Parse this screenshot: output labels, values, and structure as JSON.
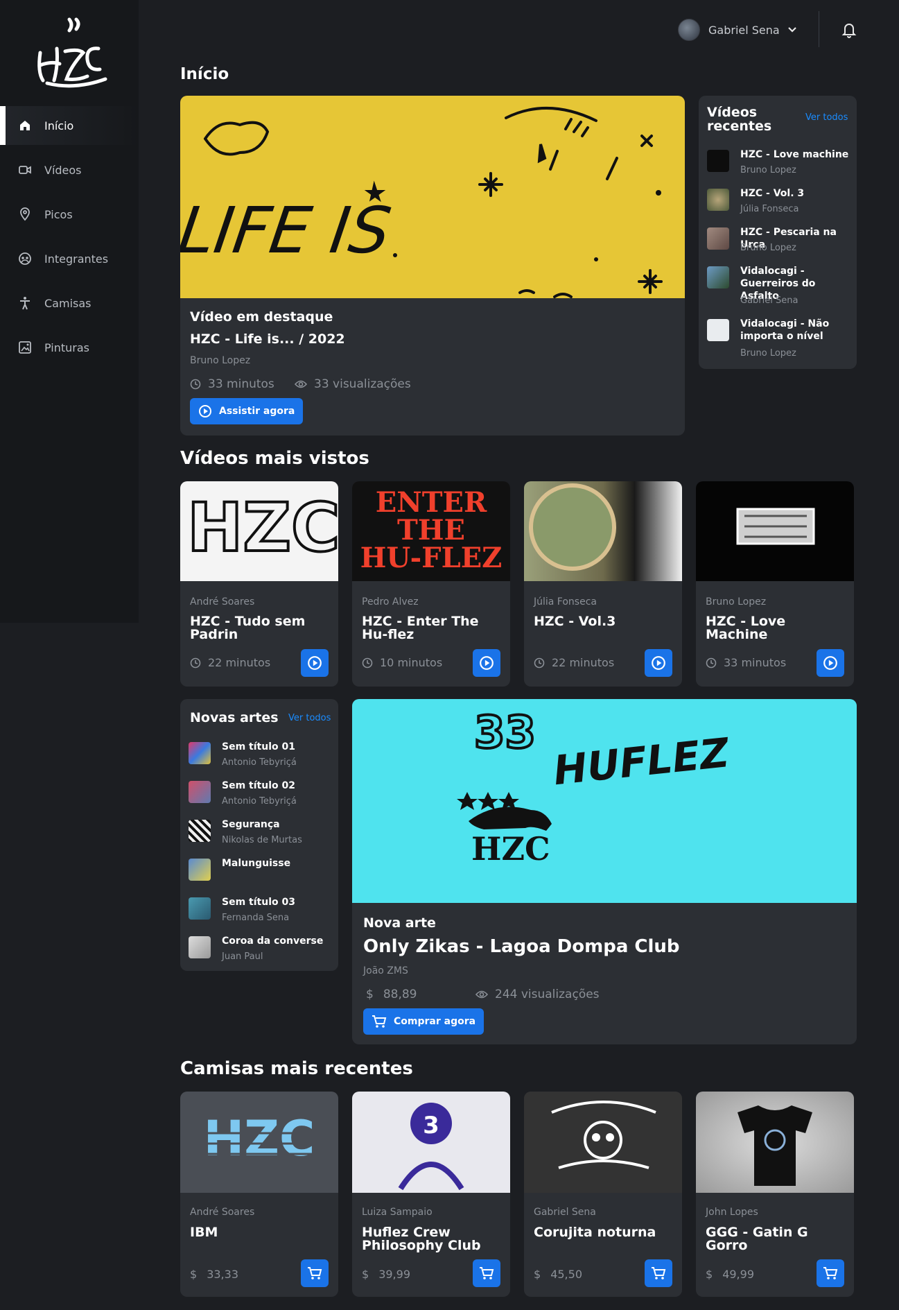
{
  "user": {
    "name": "Gabriel Sena"
  },
  "nav": [
    {
      "label": "Início",
      "icon": "home-icon"
    },
    {
      "label": "Vídeos",
      "icon": "video-camera-icon"
    },
    {
      "label": "Picos",
      "icon": "map-pin-icon"
    },
    {
      "label": "Integrantes",
      "icon": "people-icon"
    },
    {
      "label": "Camisas",
      "icon": "person-icon"
    },
    {
      "label": "Pinturas",
      "icon": "picture-icon"
    }
  ],
  "page_title": "Início",
  "featured": {
    "kicker": "Vídeo em destaque",
    "title": "HZC - Life is... / 2022",
    "author": "Bruno Lopez",
    "duration": "33 minutos",
    "views": "33 visualizações",
    "button": "Assistir agora",
    "art_text": "LIFE IS"
  },
  "recent_videos": {
    "title": "Vídeos recentes",
    "see_all": "Ver todos",
    "items": [
      {
        "title": "HZC - Love machine",
        "author": "Bruno Lopez"
      },
      {
        "title": "HZC - Vol. 3",
        "author": "Júlia Fonseca"
      },
      {
        "title": "HZC - Pescaria na Urca",
        "author": "Bruno Lopez"
      },
      {
        "title": "Vidalocagi - Guerreiros do Asfalto",
        "author": "Gabriel Sena"
      },
      {
        "title": "Vidalocagi - Não importa o nível",
        "author": "Bruno Lopez"
      }
    ]
  },
  "most_viewed": {
    "title": "Vídeos mais vistos",
    "items": [
      {
        "author": "André Soares",
        "title": "HZC - Tudo sem Padrin",
        "duration": "22 minutos"
      },
      {
        "author": "Pedro Alvez",
        "title": "HZC - Enter The Hu-flez",
        "duration": "10 minutos"
      },
      {
        "author": "Júlia Fonseca",
        "title": "HZC - Vol.3",
        "duration": "22 minutos"
      },
      {
        "author": "Bruno Lopez",
        "title": "HZC - Love Machine",
        "duration": "33 minutos"
      }
    ]
  },
  "new_arts": {
    "title": "Novas artes",
    "see_all": "Ver todos",
    "items": [
      {
        "title": "Sem título 01",
        "author": "Antonio Tebyriçá"
      },
      {
        "title": "Sem título 02",
        "author": "Antonio Tebyriçá"
      },
      {
        "title": "Segurança",
        "author": "Nikolas de Murtas"
      },
      {
        "title": "Malunguisse",
        "author": ""
      },
      {
        "title": "Sem título 03",
        "author": "Fernanda Sena"
      },
      {
        "title": "Coroa da converse",
        "author": "Juan Paul"
      }
    ]
  },
  "product_feature": {
    "kicker": "Nova arte",
    "title": "Only Zikas - Lagoa Dompa Club",
    "author": "João ZMS",
    "price": "88,89",
    "views": "244 visualizações",
    "button": "Comprar agora",
    "art_text_1": "HUFLEZ",
    "art_text_2": "HZC"
  },
  "shirts": {
    "title": "Camisas mais recentes",
    "items": [
      {
        "author": "André Soares",
        "title": "IBM",
        "price": "33,33"
      },
      {
        "author": "Luiza Sampaio",
        "title": "Huflez Crew Philosophy Club",
        "price": "39,99"
      },
      {
        "author": "Gabriel Sena",
        "title": "Corujita noturna",
        "price": "45,50"
      },
      {
        "author": "John Lopes",
        "title": "GGG - Gatin G Gorro",
        "price": "49,99"
      }
    ]
  },
  "currency_symbol": "$",
  "colors": {
    "accent": "#1a73e8",
    "featured_bg": "#e6c636",
    "product_bg": "#4fe3ee",
    "panel": "#2c2f34",
    "background": "#1c1e22"
  }
}
